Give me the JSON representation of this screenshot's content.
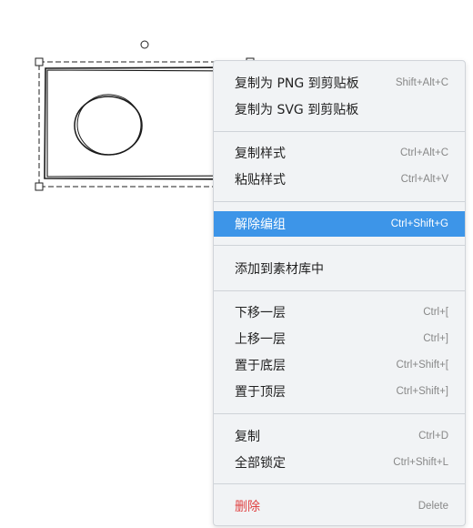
{
  "context_menu": {
    "groups": [
      {
        "items": [
          {
            "label": "复制为 PNG 到剪贴板",
            "shortcut": "Shift+Alt+C"
          },
          {
            "label": "复制为 SVG 到剪贴板",
            "shortcut": ""
          }
        ]
      },
      {
        "items": [
          {
            "label": "复制样式",
            "shortcut": "Ctrl+Alt+C"
          },
          {
            "label": "粘贴样式",
            "shortcut": "Ctrl+Alt+V"
          }
        ]
      },
      {
        "items": [
          {
            "label": "解除编组",
            "shortcut": "Ctrl+Shift+G"
          }
        ]
      },
      {
        "items": [
          {
            "label": "添加到素材库中",
            "shortcut": ""
          }
        ]
      },
      {
        "items": [
          {
            "label": "下移一层",
            "shortcut": "Ctrl+["
          },
          {
            "label": "上移一层",
            "shortcut": "Ctrl+]"
          },
          {
            "label": "置于底层",
            "shortcut": "Ctrl+Shift+["
          },
          {
            "label": "置于顶层",
            "shortcut": "Ctrl+Shift+]"
          }
        ]
      },
      {
        "items": [
          {
            "label": "复制",
            "shortcut": "Ctrl+D"
          },
          {
            "label": "全部锁定",
            "shortcut": "Ctrl+Shift+L"
          }
        ]
      },
      {
        "items": [
          {
            "label": "删除",
            "shortcut": "Delete"
          }
        ]
      }
    ],
    "highlighted_item": "解除编组",
    "colors": {
      "highlight": "#3d95e8",
      "danger": "#e04444",
      "menu_background": "#f1f3f5"
    }
  },
  "canvas": {
    "selected_shape": "hand-drawn rectangle grouped with circle",
    "selection_handles": "visible"
  }
}
